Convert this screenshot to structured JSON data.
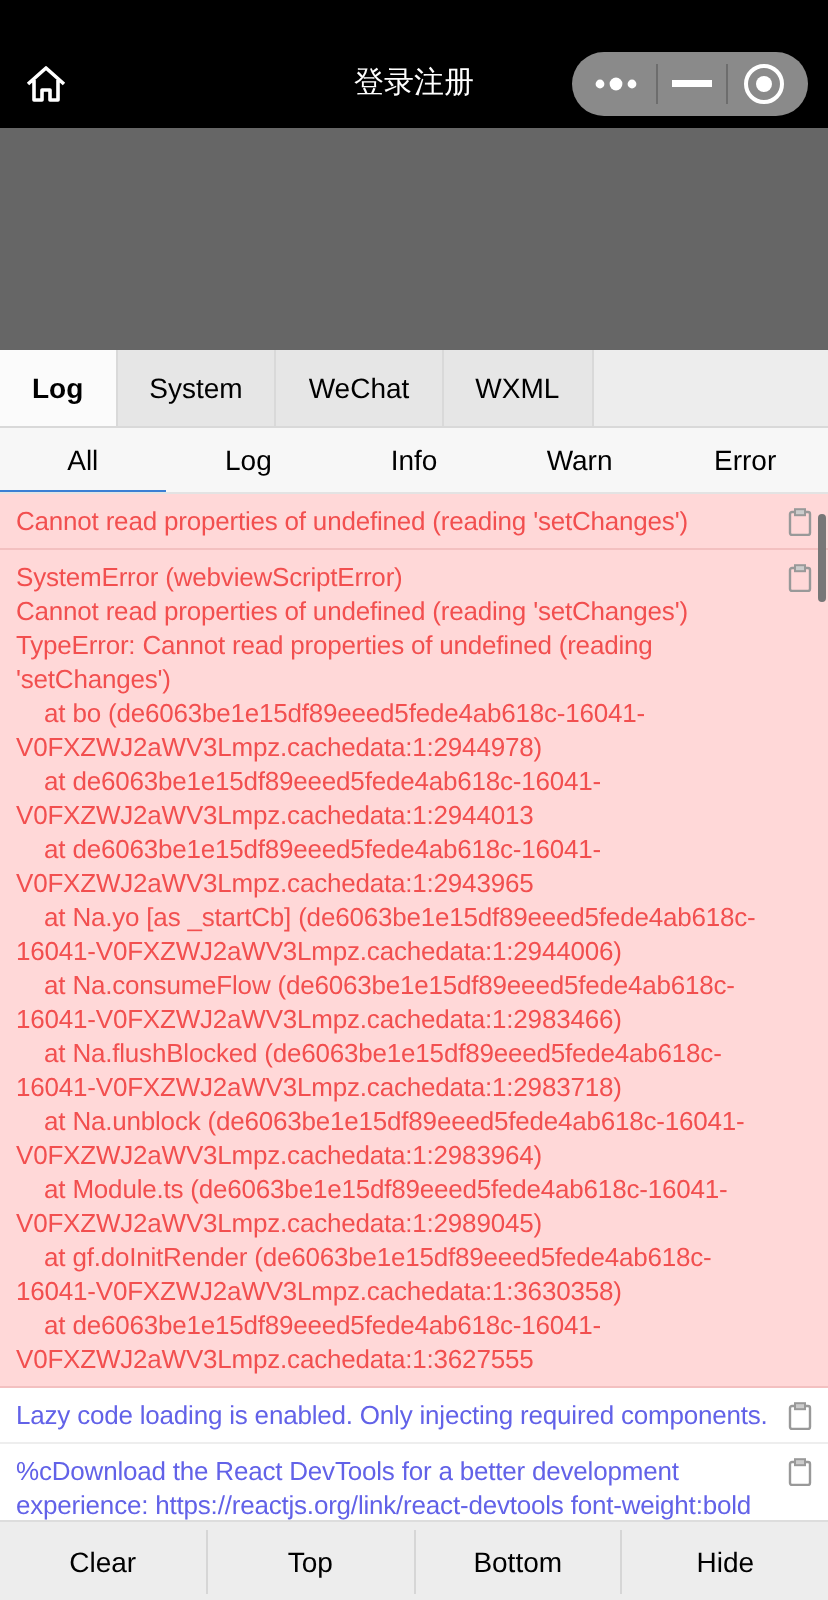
{
  "nav": {
    "title": "登录注册"
  },
  "tabs": [
    {
      "label": "Log",
      "selected": true
    },
    {
      "label": "System",
      "selected": false
    },
    {
      "label": "WeChat",
      "selected": false
    },
    {
      "label": "WXML",
      "selected": false
    }
  ],
  "filters": [
    {
      "label": "All",
      "selected": true
    },
    {
      "label": "Log",
      "selected": false
    },
    {
      "label": "Info",
      "selected": false
    },
    {
      "label": "Warn",
      "selected": false
    },
    {
      "label": "Error",
      "selected": false
    }
  ],
  "entries": [
    {
      "kind": "error",
      "text": "Cannot read properties of undefined (reading 'setChanges')"
    },
    {
      "kind": "error",
      "text": "SystemError (webviewScriptError)\nCannot read properties of undefined (reading 'setChanges')\nTypeError: Cannot read properties of undefined (reading\n'setChanges')\n    at bo (de6063be1e15df89eeed5fede4ab618c-16041-\nV0FXZWJ2aWV3Lmpz.cachedata:1:2944978)\n    at de6063be1e15df89eeed5fede4ab618c-16041-\nV0FXZWJ2aWV3Lmpz.cachedata:1:2944013\n    at de6063be1e15df89eeed5fede4ab618c-16041-\nV0FXZWJ2aWV3Lmpz.cachedata:1:2943965\n    at Na.yo [as _startCb] (de6063be1e15df89eeed5fede4ab618c-\n16041-V0FXZWJ2aWV3Lmpz.cachedata:1:2944006)\n    at Na.consumeFlow (de6063be1e15df89eeed5fede4ab618c-\n16041-V0FXZWJ2aWV3Lmpz.cachedata:1:2983466)\n    at Na.flushBlocked (de6063be1e15df89eeed5fede4ab618c-\n16041-V0FXZWJ2aWV3Lmpz.cachedata:1:2983718)\n    at Na.unblock (de6063be1e15df89eeed5fede4ab618c-16041-\nV0FXZWJ2aWV3Lmpz.cachedata:1:2983964)\n    at Module.ts (de6063be1e15df89eeed5fede4ab618c-16041-\nV0FXZWJ2aWV3Lmpz.cachedata:1:2989045)\n    at gf.doInitRender (de6063be1e15df89eeed5fede4ab618c-\n16041-V0FXZWJ2aWV3Lmpz.cachedata:1:3630358)\n    at de6063be1e15df89eeed5fede4ab618c-16041-\nV0FXZWJ2aWV3Lmpz.cachedata:1:3627555"
    },
    {
      "kind": "info",
      "text": "Lazy code loading is enabled. Only injecting required components."
    },
    {
      "kind": "info",
      "text": "%cDownload the React DevTools for a better development\nexperience: https://reactjs.org/link/react-devtools font-weight:bold"
    }
  ],
  "actions": [
    "Clear",
    "Top",
    "Bottom",
    "Hide"
  ]
}
